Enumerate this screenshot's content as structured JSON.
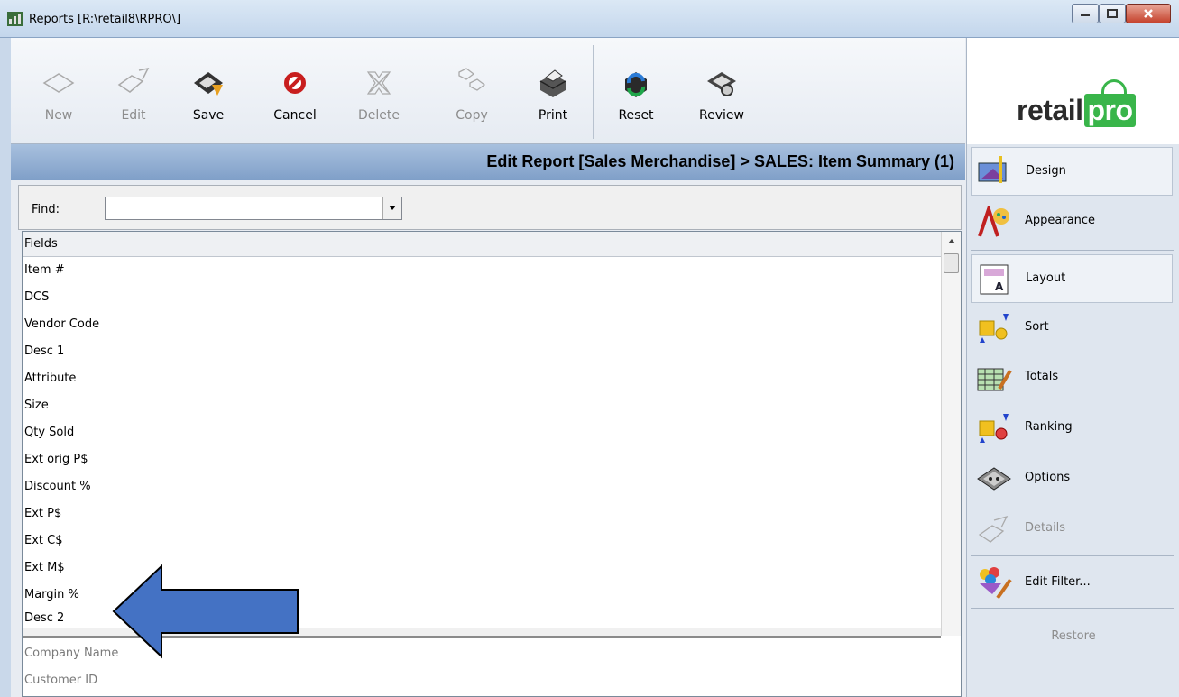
{
  "window": {
    "title": "Reports [R:\\retail8\\RPRO\\]"
  },
  "toolbar": {
    "new": "New",
    "edit": "Edit",
    "save": "Save",
    "cancel": "Cancel",
    "delete": "Delete",
    "copy": "Copy",
    "print": "Print",
    "reset": "Reset",
    "review": "Review"
  },
  "logo": {
    "part1": "retail",
    "part2": "pro",
    "brand_color": "#39b54a"
  },
  "header": {
    "title": "Edit Report [Sales Merchandise] > SALES: Item Summary (1)"
  },
  "find": {
    "label": "Find:",
    "value": ""
  },
  "fields": {
    "header": "Fields",
    "selected": [
      "Item #",
      "DCS",
      "Vendor Code",
      "Desc 1",
      "Attribute",
      "Size",
      "Qty Sold",
      "Ext orig P$",
      "Discount %",
      "Ext P$",
      "Ext C$",
      "Ext M$",
      "Margin %",
      "Desc 2"
    ],
    "available": [
      "Company Name",
      "Customer ID"
    ]
  },
  "sidebar": {
    "design": "Design",
    "appearance": "Appearance",
    "layout": "Layout",
    "sort": "Sort",
    "totals": "Totals",
    "ranking": "Ranking",
    "options": "Options",
    "details": "Details",
    "edit_filter": "Edit Filter...",
    "restore": "Restore"
  },
  "colors": {
    "header_bg": "#7f9fc8",
    "arrow": "#4472c4"
  }
}
